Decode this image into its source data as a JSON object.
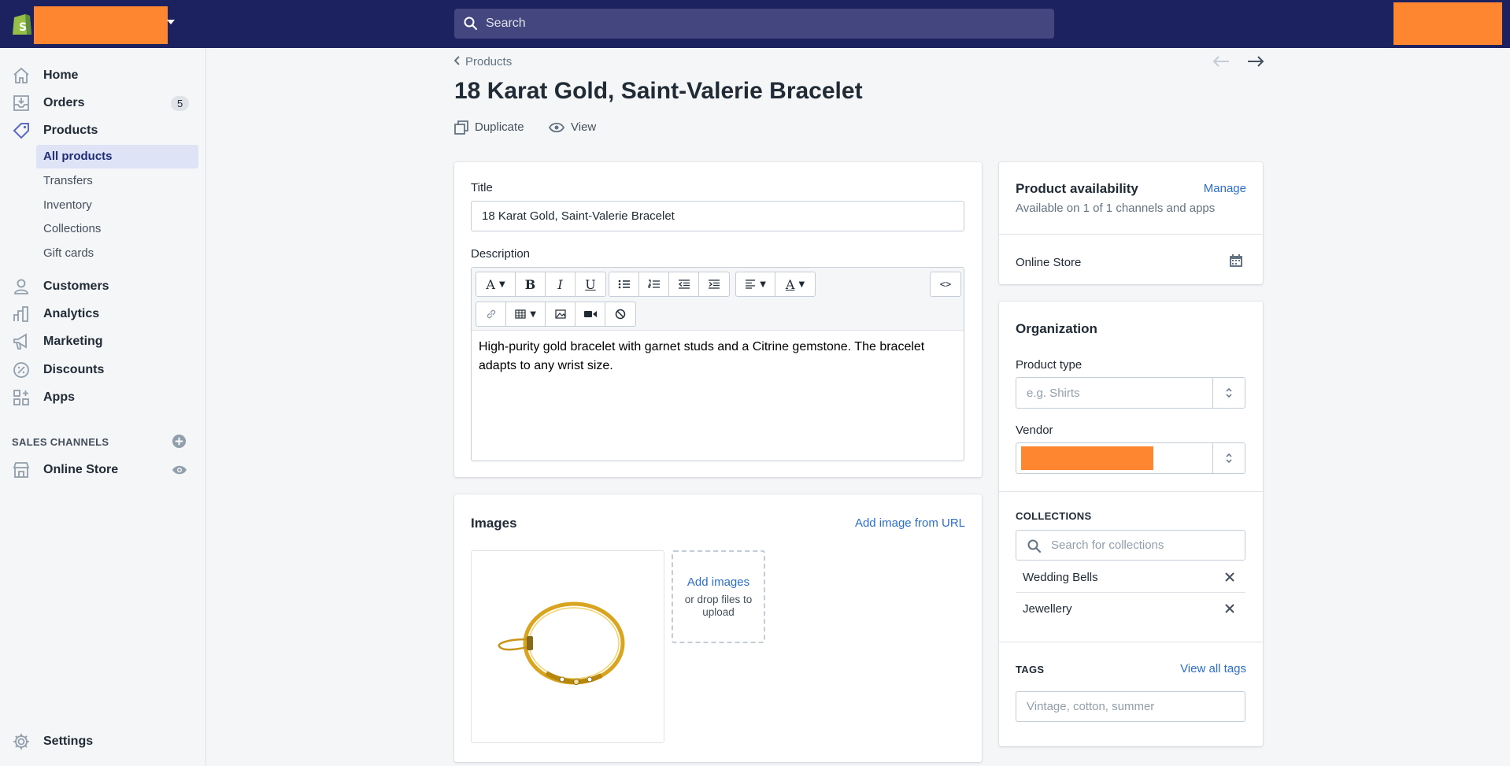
{
  "topbar": {
    "search_placeholder": "Search"
  },
  "sidebar": {
    "items": [
      {
        "label": "Home"
      },
      {
        "label": "Orders",
        "badge": "5"
      },
      {
        "label": "Products"
      },
      {
        "label": "Customers"
      },
      {
        "label": "Analytics"
      },
      {
        "label": "Marketing"
      },
      {
        "label": "Discounts"
      },
      {
        "label": "Apps"
      }
    ],
    "sub_items": [
      {
        "label": "All products"
      },
      {
        "label": "Transfers"
      },
      {
        "label": "Inventory"
      },
      {
        "label": "Collections"
      },
      {
        "label": "Gift cards"
      }
    ],
    "sales_channels_heading": "SALES CHANNELS",
    "online_store": "Online Store",
    "settings": "Settings"
  },
  "header": {
    "breadcrumb": "Products",
    "title": "18 Karat Gold, Saint-Valerie Bracelet",
    "duplicate": "Duplicate",
    "view": "View"
  },
  "product_card": {
    "title_label": "Title",
    "title_value": "18 Karat Gold, Saint-Valerie Bracelet",
    "description_label": "Description",
    "description_text": "High-purity gold bracelet with garnet studs and a Citrine gemstone. The bracelet adapts to any wrist size.",
    "code_button": "<>"
  },
  "images_card": {
    "heading": "Images",
    "add_from_url": "Add image from URL",
    "add_images": "Add images",
    "drop_hint": "or drop files to upload"
  },
  "availability_card": {
    "heading": "Product availability",
    "manage": "Manage",
    "subtext": "Available on 1 of 1 channels and apps",
    "channel": "Online Store"
  },
  "organization_card": {
    "heading": "Organization",
    "product_type_label": "Product type",
    "product_type_placeholder": "e.g. Shirts",
    "vendor_label": "Vendor",
    "collections_heading": "COLLECTIONS",
    "collections_search_placeholder": "Search for collections",
    "collections": [
      "Wedding Bells",
      "Jewellery"
    ],
    "tags_heading": "TAGS",
    "view_all_tags": "View all tags",
    "tags_placeholder": "Vintage, cotton, summer"
  },
  "colors": {
    "topbar": "#1c2260",
    "accent": "#2c6ecb",
    "redaction": "#fe8630",
    "shopify_green": "#95bf47"
  }
}
